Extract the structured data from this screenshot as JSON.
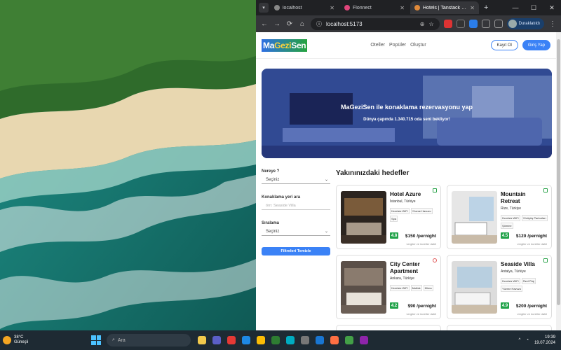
{
  "desktop": {
    "weather": {
      "temp": "38°C",
      "condition": "Güneşli"
    },
    "search_label": "Ara",
    "clock": {
      "time": "19:39",
      "date": "19.07.2024"
    }
  },
  "browser": {
    "tabs": [
      {
        "label": "localhost",
        "active": false
      },
      {
        "label": "Flonnect",
        "active": false
      },
      {
        "label": "Hotels | Tanstack Q...",
        "active": true
      }
    ],
    "url": "localhost:5173",
    "profile_name": "Duraklatıldı"
  },
  "site": {
    "logo_part1": "Ma",
    "logo_part2": "Gezi",
    "logo_part3": "Sen",
    "nav": [
      "Oteller",
      "Popüler",
      "Oluştur"
    ],
    "register_label": "Kayıt Ol",
    "login_label": "Giriş Yap",
    "hero_title": "MaGeziSen ile konaklama rezervasyonu yap",
    "hero_subtitle": "Dünya çapında 1.340.715 oda seni bekliyor!",
    "filters": {
      "where_label": "Nereye ?",
      "where_value": "Seçiniz",
      "search_label": "Konaklama yeri ara",
      "search_placeholder": "örn: Seaside Villa",
      "sort_label": "Sıralama",
      "sort_value": "Seçiniz",
      "clear_label": "Filtreleri Temizle"
    },
    "section_title": "Yakınınızdaki hedefler",
    "tax_note": "vergiler ve ücretler dahil",
    "hotels": [
      {
        "name": "Hotel Azure",
        "location": "İstanbul, Türkiye",
        "tags": [
          "Ücretsiz WiFi",
          "Yüzme Havuzu",
          "Spa"
        ],
        "rating": "4.8",
        "price": "$150 /pernight"
      },
      {
        "name": "Mountain Retreat",
        "location": "Rize, Türkiye",
        "tags": [
          "Ücretsiz WiFi",
          "Yürüyüş Parkurları",
          "Şömine"
        ],
        "rating": "4.5",
        "price": "$120 /pernight"
      },
      {
        "name": "City Center Apartment",
        "location": "Ankara, Türkiye",
        "tags": [
          "Ücretsiz WiFi",
          "Mutfak",
          "Klima"
        ],
        "rating": "4.2",
        "price": "$90 /pernight"
      },
      {
        "name": "Seaside Villa",
        "location": "Antalya, Türkiye",
        "tags": [
          "Ücretsiz WiFi",
          "Özel Plaj",
          "Yüzme Havuzu"
        ],
        "rating": "4.9",
        "price": "$200 /pernight"
      }
    ]
  }
}
